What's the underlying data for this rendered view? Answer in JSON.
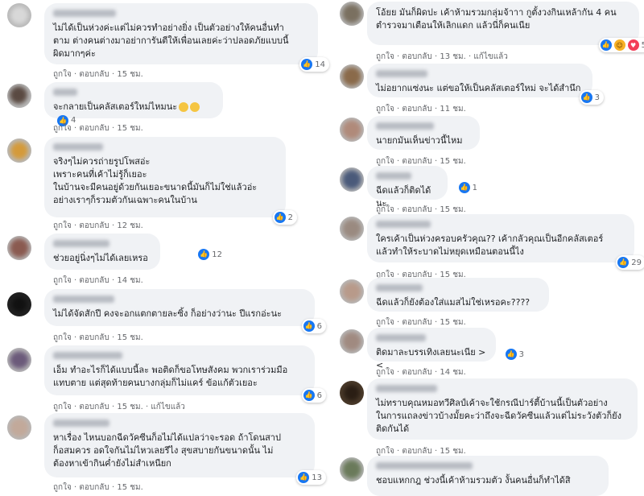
{
  "left": [
    {
      "name": "",
      "text": "ไม่ได้เป็นห่วงค่ะแต่ไม่ควรทำอย่างยิ่ง เป็นตัวอย่างให้คนอื่นทำ\nตาม ต่างคนต่างมาอย่าการันตีให้เพื่อนเลยค่ะว่าปลอดภัยแบบนี้\nผิดมากๆค่ะ",
      "likes": "14",
      "like": "ถูกใจ",
      "reply": "ตอบกลับ",
      "time": "15 ชม.",
      "edited": ""
    },
    {
      "name": "",
      "text": "จะกลายเป็นคลัสเตอร์ใหม่ไหมนะ",
      "likes": "4",
      "like": "ถูกใจ",
      "reply": "ตอบกลับ",
      "time": "15 ชม.",
      "edited": ""
    },
    {
      "name": "",
      "text": "จริงๆไม่ควรถ่ายรูปโพสอ่ะ\nเพราะคนที่เค้าไม่รู้ก็เยอะ\nในบ้านจะมีคนอยู่ด้วยกันเยอะขนาดนี้มันก็ไม่ใช่แล้วอ่ะ\nอย่างเราๆก็รวมตัวกันเฉพาะคนในบ้าน",
      "likes": "2",
      "like": "ถูกใจ",
      "reply": "ตอบกลับ",
      "time": "12 ชม.",
      "edited": ""
    },
    {
      "name": "",
      "text": "ช่วยอยู่นิ่งๆไม่ได้เลยเหรอ",
      "likes": "12",
      "like": "ถูกใจ",
      "reply": "ตอบกลับ",
      "time": "14 ชม.",
      "edited": ""
    },
    {
      "name": "",
      "text": "ไม่ได้จัดสักปี คงจะอกแตกตายละซิ้ง ก็อย่างว่านะ ปีแรกอ่ะนะ",
      "likes": "6",
      "like": "ถูกใจ",
      "reply": "ตอบกลับ",
      "time": "15 ชม.",
      "edited": ""
    },
    {
      "name": "",
      "text": "เอ็ม ทำอะไรก็ได้แบบนี้ละ พอติดก็ขอโทษสังคม พวกเราร่วมมือ\nแทบตาย แต่สุดท้ายคนบางกลุ่มก็ไม่แคร์ ข้อแก้ตัวเยอะ",
      "likes": "6",
      "like": "ถูกใจ",
      "reply": "ตอบกลับ",
      "time": "15 ชม.",
      "edited": "แก้ไขแล้ว"
    },
    {
      "name": "",
      "text": "หาเรื่อง ไหนบอกฉีดวัคซีนก็อไม่ได้แปลว่าจะรอด ถ้าโดนสาป\nก็อสมควร อดใจกันไม่ไหวเลยรึไง สุขสบายกันขนาดนั้น ไม่\nต้องหาเข้ากินค่ำยังไม่สำเหนียก",
      "likes": "13",
      "like": "ถูกใจ",
      "reply": "ตอบกลับ",
      "time": "15 ชม.",
      "edited": ""
    }
  ],
  "right": [
    {
      "name": "",
      "text": "โอ้ยย มันก็ผิดปะ เค้าห้ามรวมกลุ่มจ้าาา กูตั้งวงกินเหล้ากัน 4 คน\nตำรวจมาเตือนให้เลิกแดก แล้วนี่ก็คนเนีย",
      "likes": "5",
      "like": "ถูกใจ",
      "reply": "ตอบกลับ",
      "time": "13 ชม.",
      "edited": "แก้ไขแล้ว"
    },
    {
      "name": "",
      "text": "ไม่อยากแซ่งนะ แต่ขอให้เป็นคลัสเตอร์ใหม่ จะได้สำนึก",
      "likes": "3",
      "like": "ถูกใจ",
      "reply": "ตอบกลับ",
      "time": "11 ชม.",
      "edited": ""
    },
    {
      "name": "",
      "text": "นายกมันเห็นข่าวนี้ไหม",
      "likes": "",
      "like": "ถูกใจ",
      "reply": "ตอบกลับ",
      "time": "15 ชม.",
      "edited": ""
    },
    {
      "name": "",
      "text": "ฉีดแล้วก็ติดได้นะ",
      "likes": "1",
      "like": "ถูกใจ",
      "reply": "ตอบกลับ",
      "time": "15 ชม.",
      "edited": ""
    },
    {
      "name": "",
      "text": "ใครเค้าเป็นห่วงครอบครัวคุณ?? เค้ากลัวคุณเป็นอีกคลัสเตอร์\nแล้วทำให้ระบาดไม่หยุดเหมือนตอนนี้ไง",
      "likes": "29",
      "like": "ถูกใจ",
      "reply": "ตอบกลับ",
      "time": "15 ชม.",
      "edited": ""
    },
    {
      "name": "",
      "text": "ฉีดแล้วก็ยังต้องใส่แมสไม่ใช่เหรอคะ????",
      "likes": "",
      "like": "ถูกใจ",
      "reply": "ตอบกลับ",
      "time": "15 ชม.",
      "edited": ""
    },
    {
      "name": "",
      "text": "ติดมาละบรรเทิงเลยนะเนีย > <",
      "likes": "3",
      "like": "ถูกใจ",
      "reply": "ตอบกลับ",
      "time": "14 ชม.",
      "edited": ""
    },
    {
      "name": "",
      "text": "ไม่ทราบคุณหมอทวีศิลป์เค้าจะใช้กรณีปาร์ตี้บ้านนี้เป็นตัวอย่าง\nในการแถลงข่าวบ้างมั้ยคะว่าถึงจะฉีดวัคซีนแล้วแต่ไม่ระวังตัวก็ยัง\nติดกันได้",
      "likes": "",
      "like": "ถูกใจ",
      "reply": "ตอบกลับ",
      "time": "15 ชม.",
      "edited": ""
    },
    {
      "name": "",
      "text": "ชอบแหกกฎ ช่วงนี้เค้าห้ามรวมตัว งั้นคนอื่นก็ทำได้สิ",
      "likes": "",
      "like": "ถูกใจ",
      "reply": "ตอบกลับ",
      "time": "",
      "edited": ""
    }
  ]
}
